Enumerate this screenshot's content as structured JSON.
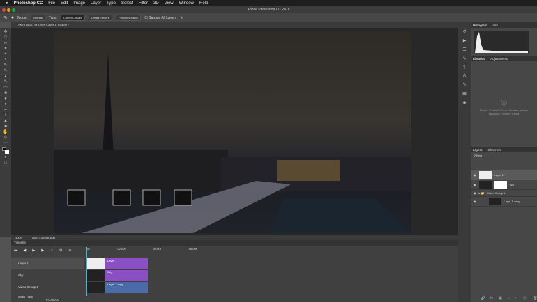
{
  "menubar": {
    "apple": "",
    "app": "Photoshop CC",
    "items": [
      "File",
      "Edit",
      "Image",
      "Layer",
      "Type",
      "Select",
      "Filter",
      "3D",
      "View",
      "Window",
      "Help"
    ]
  },
  "titlebar": {
    "title": "Adobe Photoshop CC 2018"
  },
  "options": {
    "mode_label": "Mode:",
    "mode_value": "Normal",
    "type_label": "Type:",
    "types": [
      "Content-Aware",
      "Create Texture",
      "Proximity Match"
    ],
    "sample_all": "Sample All Layers"
  },
  "document": {
    "tab": "SKY57AS47 @ 100% (Layer 1, RGB/8) *"
  },
  "status": {
    "zoom": "100%",
    "doc": "Doc: 3.47M/8.46M"
  },
  "timeline": {
    "title": "Timeline",
    "ruler": [
      "00",
      "02:00f",
      "04:00f",
      "06:00f"
    ],
    "tracks": [
      {
        "name": "Layer 1",
        "clip": "Layer 1",
        "color": "#8a4fc4"
      },
      {
        "name": "Sky",
        "clip": "Sky",
        "color": "#8a4fc4"
      },
      {
        "name": "Video Group 1",
        "clip": "Layer 1 copy",
        "color": "#4a6aa8"
      }
    ],
    "audio": "Audio Track",
    "timecode": "0:00:00:07"
  },
  "panels": {
    "histogram_tabs": [
      "Histogram",
      "Info"
    ],
    "libraries_tabs": [
      "Libraries",
      "Adjustments"
    ],
    "libraries_msg": "To use Creative Cloud Libraries, please sign in to Creative Cloud",
    "layers_tabs": [
      "Layers",
      "Channels"
    ],
    "kind": "Kind",
    "layers": [
      {
        "name": "Layer 1"
      },
      {
        "name": "Sky"
      },
      {
        "name": "Video Group 1"
      },
      {
        "name": "Layer 1 copy"
      }
    ]
  }
}
